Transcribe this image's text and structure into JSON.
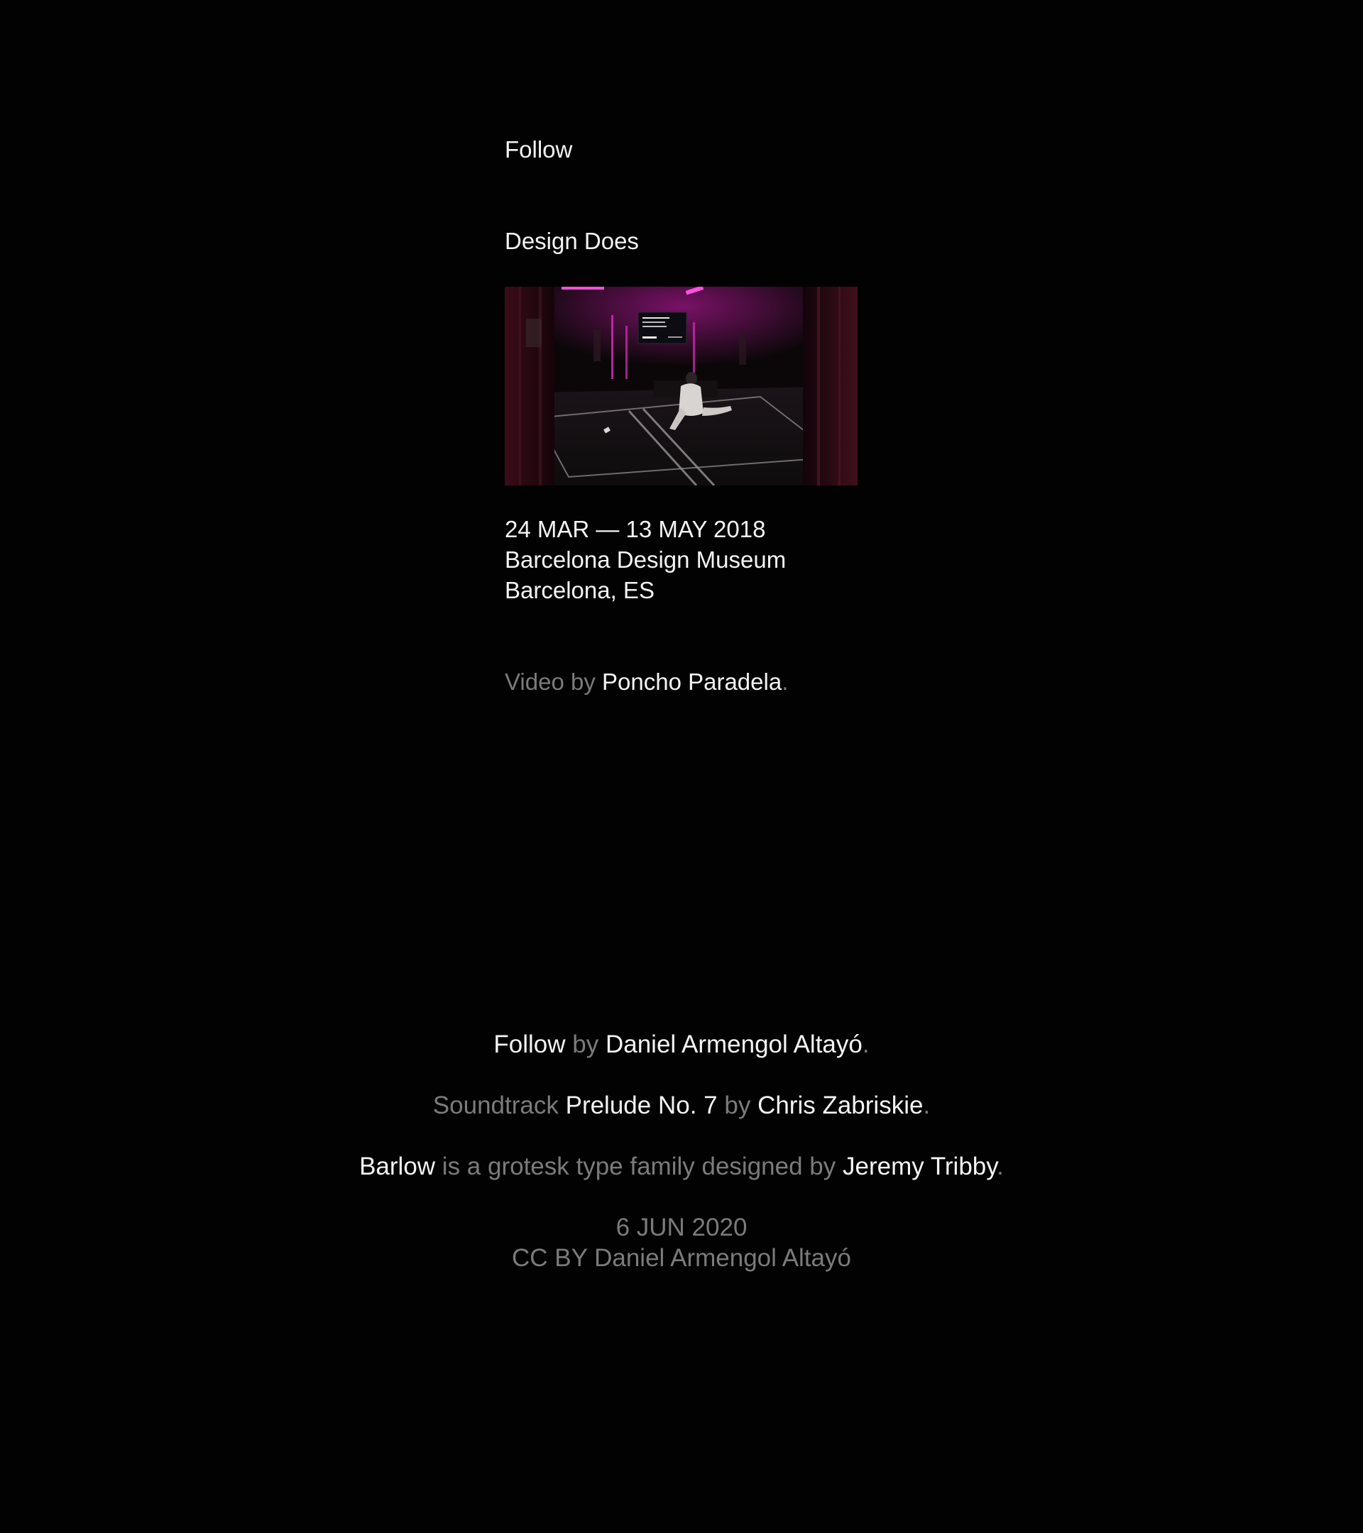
{
  "project": {
    "title": "Follow",
    "exhibition": "Design Does",
    "media": {
      "kind": "video-still",
      "screen_lines": [
        "Agafa el controlador.",
        "Coge el controlador.",
        "Take the controller."
      ],
      "screen_timer": "01:44:37"
    },
    "dates": "24 MAR — 13 MAY 2018",
    "venue": "Barcelona Design Museum",
    "city": "Barcelona, ES",
    "credit": {
      "prefix": "Video by",
      "name": "Poncho Paradela",
      "suffix": "."
    }
  },
  "footer": {
    "line1": {
      "title": "Follow",
      "by": "by",
      "author": "Daniel Armengol Altayó",
      "end": "."
    },
    "line2": {
      "label": "Soundtrack",
      "track": "Prelude No. 7",
      "by": "by",
      "artist": "Chris Zabriskie",
      "end": "."
    },
    "line3": {
      "font": "Barlow",
      "text": "is a grotesk type family designed by",
      "designer": "Jeremy Tribby",
      "end": "."
    },
    "date": "6 JUN 2020",
    "license": "CC BY Daniel Armengol Altayó"
  },
  "colors": {
    "background": "#020202",
    "text": "#f4f4f4",
    "muted": "#7b7b7b",
    "accent_magenta": "#d21bb4"
  }
}
